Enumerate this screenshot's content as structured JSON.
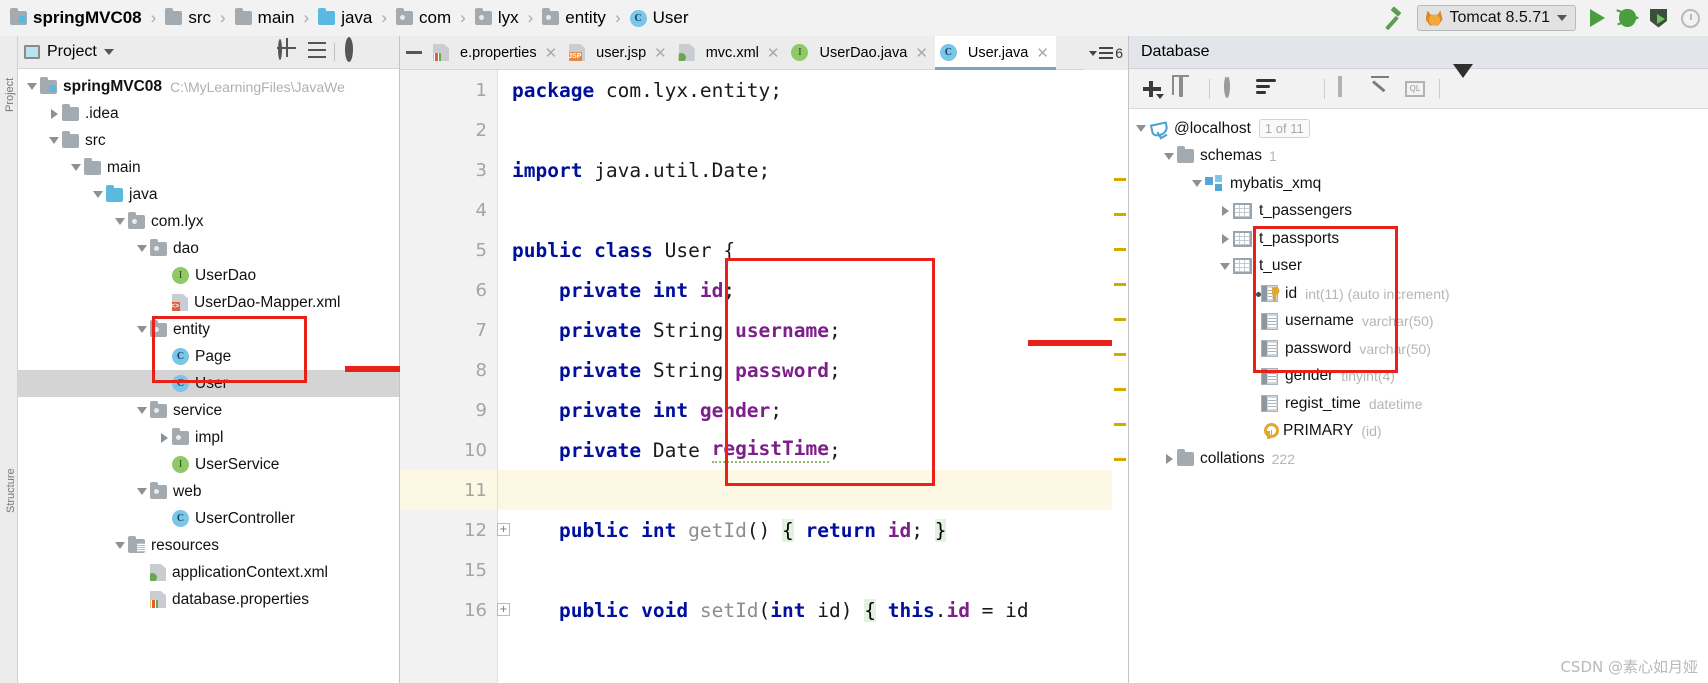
{
  "breadcrumb": {
    "items": [
      {
        "label": "springMVC08",
        "icon": "module-folder-icon",
        "bold": true
      },
      {
        "label": "src",
        "icon": "folder-icon",
        "bold": false
      },
      {
        "label": "main",
        "icon": "folder-icon",
        "bold": false
      },
      {
        "label": "java",
        "icon": "source-folder-icon",
        "bold": false
      },
      {
        "label": "com",
        "icon": "package-folder-icon",
        "bold": false
      },
      {
        "label": "lyx",
        "icon": "package-folder-icon",
        "bold": false
      },
      {
        "label": "entity",
        "icon": "package-folder-icon",
        "bold": false
      },
      {
        "label": "User",
        "icon": "java-class-icon",
        "bold": false
      }
    ]
  },
  "toolbar": {
    "build_tooltip": "Build Project",
    "run_config": "Tomcat 8.5.71",
    "run_label": "Run",
    "debug_label": "Debug",
    "run_with_coverage_label": "Run with Coverage",
    "profiler_label": "Profiler"
  },
  "project_panel": {
    "title": "Project",
    "rail_labels": [
      "Project",
      "Structure"
    ],
    "tree": [
      {
        "indent": 0,
        "toggle": "down",
        "icon": "module-folder-icon",
        "label": "springMVC08",
        "bold": true,
        "path": "C:\\MyLearningFiles\\JavaWe"
      },
      {
        "indent": 1,
        "toggle": "right",
        "icon": "folder-icon",
        "label": ".idea",
        "bold": false,
        "path": ""
      },
      {
        "indent": 1,
        "toggle": "down",
        "icon": "folder-icon",
        "label": "src",
        "bold": false,
        "path": ""
      },
      {
        "indent": 2,
        "toggle": "down",
        "icon": "folder-icon",
        "label": "main",
        "bold": false,
        "path": ""
      },
      {
        "indent": 3,
        "toggle": "down",
        "icon": "source-folder-icon",
        "label": "java",
        "bold": false,
        "path": ""
      },
      {
        "indent": 4,
        "toggle": "down",
        "icon": "package-folder-icon",
        "label": "com.lyx",
        "bold": false,
        "path": ""
      },
      {
        "indent": 5,
        "toggle": "down",
        "icon": "package-folder-icon",
        "label": "dao",
        "bold": false,
        "path": ""
      },
      {
        "indent": 6,
        "toggle": "none",
        "icon": "java-interface-icon",
        "label": "UserDao",
        "bold": false,
        "path": ""
      },
      {
        "indent": 6,
        "toggle": "none",
        "icon": "xml-file-icon",
        "label": "UserDao-Mapper.xml",
        "bold": false,
        "path": ""
      },
      {
        "indent": 5,
        "toggle": "down",
        "icon": "package-folder-icon",
        "label": "entity",
        "bold": false,
        "path": ""
      },
      {
        "indent": 6,
        "toggle": "none",
        "icon": "java-class-icon",
        "label": "Page",
        "bold": false,
        "path": ""
      },
      {
        "indent": 6,
        "toggle": "none",
        "icon": "java-class-icon",
        "label": "User",
        "bold": false,
        "path": "",
        "selected": true
      },
      {
        "indent": 5,
        "toggle": "down",
        "icon": "package-folder-icon",
        "label": "service",
        "bold": false,
        "path": ""
      },
      {
        "indent": 6,
        "toggle": "right",
        "icon": "package-folder-icon",
        "label": "impl",
        "bold": false,
        "path": ""
      },
      {
        "indent": 6,
        "toggle": "none",
        "icon": "java-interface-icon",
        "label": "UserService",
        "bold": false,
        "path": ""
      },
      {
        "indent": 5,
        "toggle": "down",
        "icon": "package-folder-icon",
        "label": "web",
        "bold": false,
        "path": ""
      },
      {
        "indent": 6,
        "toggle": "none",
        "icon": "java-class-icon",
        "label": "UserController",
        "bold": false,
        "path": ""
      },
      {
        "indent": 4,
        "toggle": "down",
        "icon": "resources-folder-icon",
        "label": "resources",
        "bold": false,
        "path": ""
      },
      {
        "indent": 5,
        "toggle": "none",
        "icon": "spring-xml-file-icon",
        "label": "applicationContext.xml",
        "bold": false,
        "path": ""
      },
      {
        "indent": 5,
        "toggle": "none",
        "icon": "properties-file-icon",
        "label": "database.properties",
        "bold": false,
        "path": ""
      }
    ]
  },
  "editor": {
    "tabs": [
      {
        "label": "e.properties",
        "icon": "properties-file-icon",
        "active": false,
        "closable": true
      },
      {
        "label": "user.jsp",
        "icon": "jsp-file-icon",
        "active": false,
        "closable": true
      },
      {
        "label": "mvc.xml",
        "icon": "spring-xml-file-icon",
        "active": false,
        "closable": true
      },
      {
        "label": "UserDao.java",
        "icon": "java-interface-icon",
        "active": false,
        "closable": true
      },
      {
        "label": "User.java",
        "icon": "java-class-icon",
        "active": true,
        "closable": true
      }
    ],
    "tab_overflow_count": "6",
    "lines": [
      {
        "num": "1",
        "fold": false,
        "current": false,
        "tokens": [
          {
            "t": "package ",
            "c": "kw"
          },
          {
            "t": "com.lyx.entity;",
            "c": "pl"
          }
        ]
      },
      {
        "num": "2",
        "fold": false,
        "current": false,
        "tokens": []
      },
      {
        "num": "3",
        "fold": false,
        "current": false,
        "tokens": [
          {
            "t": "import ",
            "c": "kw"
          },
          {
            "t": "java.util.Date;",
            "c": "pl"
          }
        ]
      },
      {
        "num": "4",
        "fold": false,
        "current": false,
        "tokens": []
      },
      {
        "num": "5",
        "fold": false,
        "current": false,
        "tokens": [
          {
            "t": "public class ",
            "c": "kw"
          },
          {
            "t": "User {",
            "c": "pl"
          }
        ]
      },
      {
        "num": "6",
        "fold": false,
        "current": false,
        "tokens": [
          {
            "t": "    private int ",
            "c": "kw"
          },
          {
            "t": "id",
            "c": "fld"
          },
          {
            "t": ";",
            "c": "pl"
          }
        ]
      },
      {
        "num": "7",
        "fold": false,
        "current": false,
        "tokens": [
          {
            "t": "    private ",
            "c": "kw"
          },
          {
            "t": "String ",
            "c": "pl"
          },
          {
            "t": "username",
            "c": "fld"
          },
          {
            "t": ";",
            "c": "pl"
          }
        ]
      },
      {
        "num": "8",
        "fold": false,
        "current": false,
        "tokens": [
          {
            "t": "    private ",
            "c": "kw"
          },
          {
            "t": "String ",
            "c": "pl"
          },
          {
            "t": "password",
            "c": "fld"
          },
          {
            "t": ";",
            "c": "pl"
          }
        ]
      },
      {
        "num": "9",
        "fold": false,
        "current": false,
        "tokens": [
          {
            "t": "    private int ",
            "c": "kw"
          },
          {
            "t": "gender",
            "c": "fld"
          },
          {
            "t": ";",
            "c": "pl"
          }
        ]
      },
      {
        "num": "10",
        "fold": false,
        "current": false,
        "tokens": [
          {
            "t": "    private ",
            "c": "kw"
          },
          {
            "t": "Date ",
            "c": "pl"
          },
          {
            "t": "registTime",
            "c": "fld squig"
          },
          {
            "t": ";",
            "c": "pl"
          }
        ]
      },
      {
        "num": "11",
        "fold": false,
        "current": true,
        "tokens": []
      },
      {
        "num": "12",
        "fold": true,
        "current": false,
        "tokens": [
          {
            "t": "    public int ",
            "c": "kw"
          },
          {
            "t": "getId",
            "c": "mth"
          },
          {
            "t": "() ",
            "c": "pl"
          },
          {
            "t": "{",
            "c": "brace"
          },
          {
            "t": " ",
            "c": "pl"
          },
          {
            "t": "return ",
            "c": "kw"
          },
          {
            "t": "id",
            "c": "fld"
          },
          {
            "t": "; ",
            "c": "pl"
          },
          {
            "t": "}",
            "c": "brace"
          }
        ]
      },
      {
        "num": "15",
        "fold": false,
        "current": false,
        "tokens": []
      },
      {
        "num": "16",
        "fold": true,
        "current": false,
        "tokens": [
          {
            "t": "    public void ",
            "c": "kw"
          },
          {
            "t": "setId",
            "c": "mth"
          },
          {
            "t": "(",
            "c": "pl"
          },
          {
            "t": "int ",
            "c": "kw"
          },
          {
            "t": "id",
            "c": "pl"
          },
          {
            "t": ") ",
            "c": "pl"
          },
          {
            "t": "{",
            "c": "brace"
          },
          {
            "t": " ",
            "c": "pl"
          },
          {
            "t": "this",
            "c": "kw"
          },
          {
            "t": ".",
            "c": "pl"
          },
          {
            "t": "id",
            "c": "fld"
          },
          {
            "t": " = ",
            "c": "pl"
          },
          {
            "t": "id",
            "c": "pl"
          }
        ]
      }
    ]
  },
  "database_panel": {
    "title": "Database",
    "toolbar_icons": [
      "plus-icon",
      "copy-icon",
      "refresh-icon",
      "sync-icon",
      "stop-icon",
      "grid-icon",
      "edit-icon",
      "query-console-icon",
      "filter-icon"
    ],
    "tree": [
      {
        "indent": 0,
        "toggle": "down",
        "icon": "mysql-icon",
        "label": "@localhost",
        "type": "",
        "badge": "1 of 11"
      },
      {
        "indent": 1,
        "toggle": "down",
        "icon": "folder-icon",
        "label": "schemas",
        "type": "",
        "count": "1"
      },
      {
        "indent": 2,
        "toggle": "down",
        "icon": "schema-icon",
        "label": "mybatis_xmq",
        "type": "",
        "count": ""
      },
      {
        "indent": 3,
        "toggle": "right",
        "icon": "table-icon",
        "label": "t_passengers",
        "type": "",
        "count": ""
      },
      {
        "indent": 3,
        "toggle": "right",
        "icon": "table-icon",
        "label": "t_passports",
        "type": "",
        "count": ""
      },
      {
        "indent": 3,
        "toggle": "down",
        "icon": "table-icon",
        "label": "t_user",
        "type": "",
        "count": ""
      },
      {
        "indent": 4,
        "toggle": "none",
        "icon": "primary-key-column-icon",
        "label": "id",
        "type": "int(11) (auto increment)",
        "count": ""
      },
      {
        "indent": 4,
        "toggle": "none",
        "icon": "column-icon",
        "label": "username",
        "type": "varchar(50)",
        "count": ""
      },
      {
        "indent": 4,
        "toggle": "none",
        "icon": "column-icon",
        "label": "password",
        "type": "varchar(50)",
        "count": ""
      },
      {
        "indent": 4,
        "toggle": "none",
        "icon": "column-icon",
        "label": "gender",
        "type": "tinyint(4)",
        "count": ""
      },
      {
        "indent": 4,
        "toggle": "none",
        "icon": "column-icon",
        "label": "regist_time",
        "type": "datetime",
        "count": ""
      },
      {
        "indent": 4,
        "toggle": "none",
        "icon": "key-icon",
        "label": "PRIMARY",
        "type": "(id)",
        "count": ""
      },
      {
        "indent": 1,
        "toggle": "right",
        "icon": "folder-icon",
        "label": "collations",
        "type": "",
        "count": "222"
      }
    ]
  },
  "annotations": {
    "watermark": "CSDN @素心如月娅",
    "highlight_color": "#e8211a"
  }
}
